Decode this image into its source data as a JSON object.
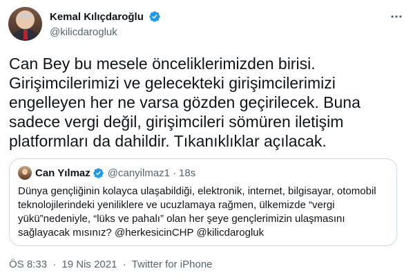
{
  "author": {
    "display_name": "Kemal Kılıçdaroğlu",
    "handle": "@kilicdarogluk"
  },
  "tweet": {
    "text": "Can Bey bu mesele önceliklerimizden birisi.\nGirişimcilerimizi ve gelecekteki girişimcilerimizi\nengelleyen her ne varsa gözden geçirilecek. Buna\nsadece vergi değil, girişimcileri sömüren iletişim\nplatformları da dahildir. Tıkanıklıklar açılacak."
  },
  "quoted": {
    "display_name": "Can Yılmaz",
    "handle": "@canyilmaz1",
    "dot": "·",
    "time": "18s",
    "text": "Dünya gençliğinin kolayca ulaşabildiği, elektronik, internet, bilgisayar, otomobil\nteknolojilerindeki yeniliklere ve ucuzlamaya rağmen, ülkemizde “vergi\nyükü”nedeniyle,  “lüks ve pahalı” olan her şeye gençlerimizin ulaşmasını\nsağlayacak mısınız? @herkesicinCHP @kilicdarogluk"
  },
  "meta": {
    "time": "ÖS 8:33",
    "sep1": "·",
    "date": "19 Nis 2021",
    "sep2": "·",
    "source": "Twitter for iPhone"
  },
  "colors": {
    "verified": "#1d9bf0",
    "secondary_text": "#536471",
    "border": "#cfd9de"
  },
  "icons": {
    "verified": "verified-badge-icon",
    "more": "more-horizontal-icon"
  }
}
